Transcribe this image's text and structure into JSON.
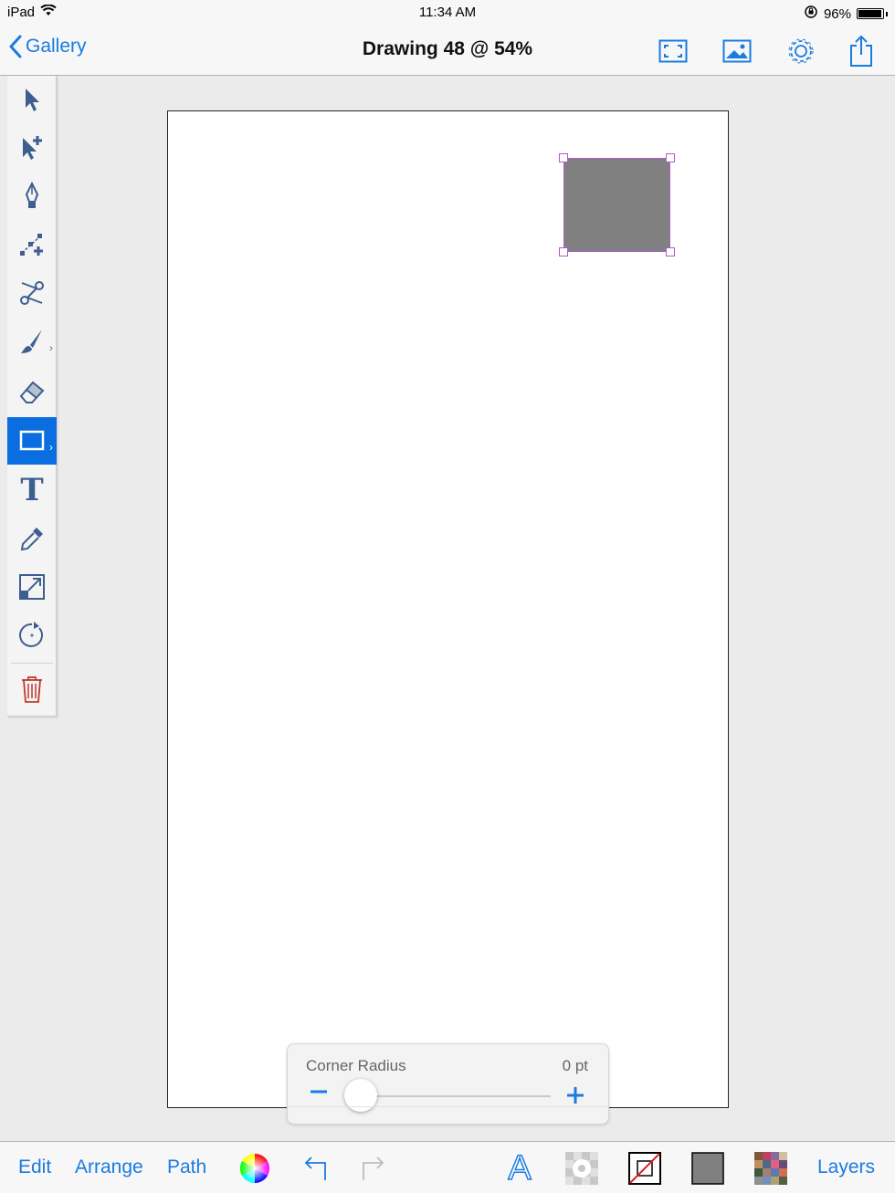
{
  "status_bar": {
    "carrier": "iPad",
    "time": "11:34 AM",
    "battery": "96%"
  },
  "nav": {
    "back_label": "Gallery",
    "title": "Drawing 48 @ 54%"
  },
  "toolbar": {
    "tools": [
      "select-tool",
      "direct-select-tool",
      "pen-tool",
      "add-anchor-tool",
      "scissors-tool",
      "brush-tool",
      "eraser-tool",
      "rectangle-tool",
      "text-tool",
      "eyedropper-tool",
      "scale-tool",
      "rotate-tool",
      "delete-tool"
    ],
    "active_tool": "rectangle-tool",
    "text_tool_glyph": "T"
  },
  "canvas": {
    "shape_fill": "#808080",
    "selection_color": "#b05cc8"
  },
  "corner_radius_popover": {
    "label": "Corner Radius",
    "value": "0 pt",
    "minus": "−",
    "plus": "+"
  },
  "bottom_bar": {
    "edit": "Edit",
    "arrange": "Arrange",
    "path": "Path",
    "layers": "Layers",
    "font_glyph": "A"
  },
  "colors": {
    "accent": "#1a7be0",
    "active_tool_bg": "#0a6ee0",
    "delete": "#c0392b"
  }
}
